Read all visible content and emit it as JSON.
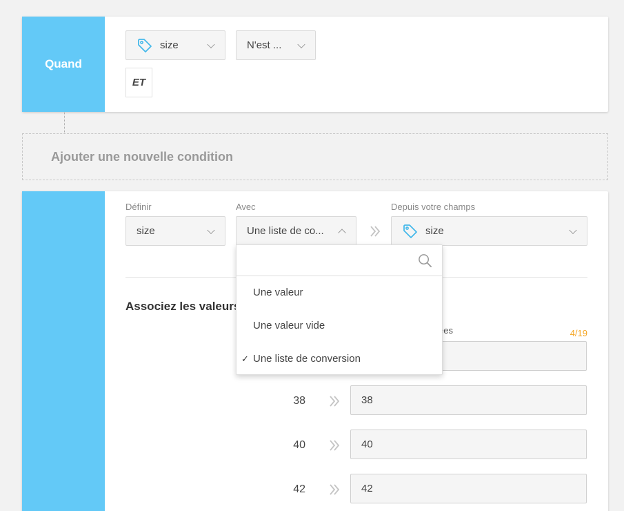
{
  "condition": {
    "side_label": "Quand",
    "field_select": "size",
    "operator_select": "N'est ...",
    "and_label": "ET"
  },
  "add_condition": {
    "label": "Ajouter une nouvelle condition"
  },
  "action": {
    "define_label": "Définir",
    "define_value": "size",
    "with_label": "Avec",
    "with_value": "Une liste de co...",
    "from_label": "Depuis votre champs",
    "from_value": "size",
    "map_title": "Associez les valeurs",
    "mapped_header": "ées",
    "counter": "4/19",
    "rows": [
      {
        "source": "38",
        "target": "38"
      },
      {
        "source": "40",
        "target": "40"
      },
      {
        "source": "42",
        "target": "42"
      }
    ]
  },
  "dropdown": {
    "search_placeholder": "",
    "options": [
      {
        "label": "Une valeur",
        "selected": false
      },
      {
        "label": "Une valeur vide",
        "selected": false
      },
      {
        "label": "Une liste de conversion",
        "selected": true
      }
    ]
  },
  "icons": {
    "tag": "tag-icon",
    "search": "search-icon",
    "chevron": "chevron-down-icon",
    "arrow": "double-chevron-right-icon",
    "check": "check-icon"
  },
  "colors": {
    "accent": "#63c9f7",
    "counter": "#f5a623"
  }
}
